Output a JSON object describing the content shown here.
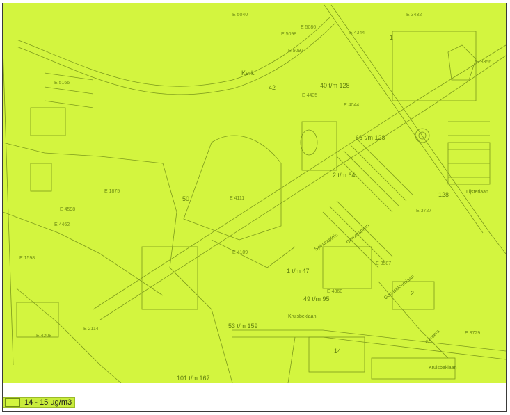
{
  "map": {
    "fill_color": "#d3f53f",
    "line_color": "#7d9a1c",
    "labels": [
      {
        "text": "Kerk"
      },
      {
        "text": "42"
      },
      {
        "text": "128"
      },
      {
        "text": "40 t/m 128"
      },
      {
        "text": "66 t/m 128"
      },
      {
        "text": "2 t/m 64"
      },
      {
        "text": "49 t/m 95"
      },
      {
        "text": "1 t/m 47"
      },
      {
        "text": "53 t/m 159"
      },
      {
        "text": "101 t/m 167"
      },
      {
        "text": "50"
      },
      {
        "text": "1"
      },
      {
        "text": "2"
      },
      {
        "text": "14"
      }
    ],
    "streets": [
      {
        "text": "Spiraeaplein"
      },
      {
        "text": "Gerberaplein"
      },
      {
        "text": "Goudsbloemlaan"
      },
      {
        "text": "Kruisbeklaan"
      },
      {
        "text": "Kruisbeklaan"
      },
      {
        "text": "Lijsterlaan"
      },
      {
        "text": "Gerbera"
      }
    ],
    "building_codes": [
      {
        "text": "E 5040"
      },
      {
        "text": "E 3432"
      },
      {
        "text": "E 5086"
      },
      {
        "text": "E 5098"
      },
      {
        "text": "E 3356"
      },
      {
        "text": "E 4344"
      },
      {
        "text": "E 5097"
      },
      {
        "text": "E 4109"
      },
      {
        "text": "E 4111"
      },
      {
        "text": "E 4598"
      },
      {
        "text": "E 3727"
      },
      {
        "text": "E 3587"
      },
      {
        "text": "E 4360"
      },
      {
        "text": "E 3729"
      },
      {
        "text": "E 4208"
      },
      {
        "text": "E 2114"
      },
      {
        "text": "E 5166"
      },
      {
        "text": "E 4044"
      },
      {
        "text": "E 1875"
      },
      {
        "text": "E 1598"
      },
      {
        "text": "E 4462"
      },
      {
        "text": "E 4435"
      }
    ]
  },
  "legend": {
    "label": "14 - 15 µg/m3",
    "color": "#d3f53f"
  }
}
